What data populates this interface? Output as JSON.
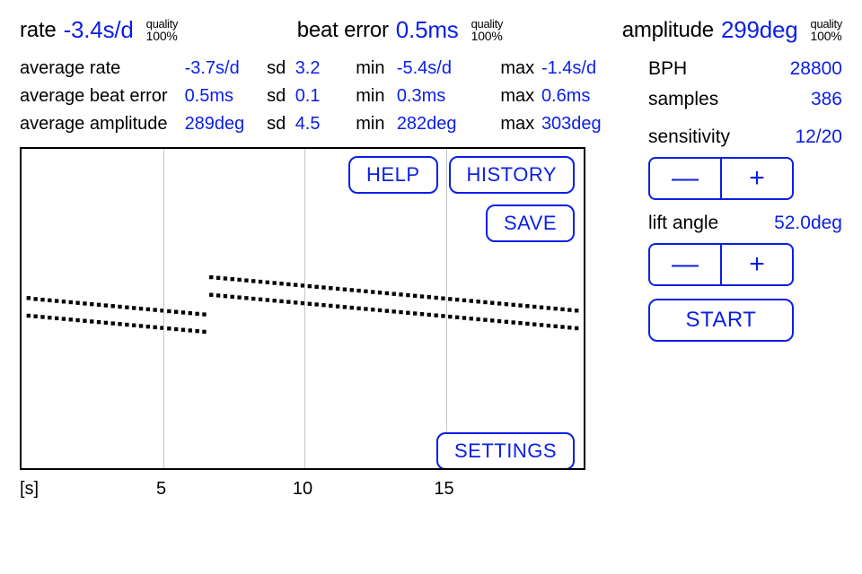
{
  "readings": {
    "rate": {
      "label": "rate",
      "value": "-3.4s/d",
      "quality_label": "quality",
      "quality": "100%"
    },
    "beat_error": {
      "label": "beat error",
      "value": "0.5ms",
      "quality_label": "quality",
      "quality": "100%"
    },
    "amplitude": {
      "label": "amplitude",
      "value": "299deg",
      "quality_label": "quality",
      "quality": "100%"
    }
  },
  "averages": {
    "rate": {
      "label": "average rate",
      "value": "-3.7s/d",
      "sd_label": "sd",
      "sd": "3.2",
      "min_label": "min",
      "min": "-5.4s/d",
      "max_label": "max",
      "max": "-1.4s/d"
    },
    "beat_error": {
      "label": "average beat error",
      "value": "0.5ms",
      "sd_label": "sd",
      "sd": "0.1",
      "min_label": "min",
      "min": "0.3ms",
      "max_label": "max",
      "max": "0.6ms"
    },
    "amplitude": {
      "label": "average amplitude",
      "value": "289deg",
      "sd_label": "sd",
      "sd": "4.5",
      "min_label": "min",
      "min": "282deg",
      "max_label": "max",
      "max": "303deg"
    }
  },
  "side": {
    "bph_label": "BPH",
    "bph": "28800",
    "samples_label": "samples",
    "samples": "386",
    "sensitivity_label": "sensitivity",
    "sensitivity": "12/20",
    "lift_label": "lift angle",
    "lift": "52.0deg",
    "minus": "—",
    "plus": "+",
    "start": "START"
  },
  "buttons": {
    "help": "HELP",
    "history": "HISTORY",
    "save": "SAVE",
    "settings": "SETTINGS"
  },
  "chart_data": {
    "type": "scatter",
    "xlabel": "[s]",
    "x_ticks": [
      "5",
      "10",
      "15"
    ],
    "x_range": [
      0,
      20
    ],
    "gridlines_x": [
      5,
      10,
      15
    ],
    "series": [
      {
        "name": "trace-upper",
        "points": [
          [
            0.25,
            0.535
          ],
          [
            0.5,
            0.532
          ],
          [
            0.75,
            0.53
          ],
          [
            1.0,
            0.528
          ],
          [
            1.25,
            0.526
          ],
          [
            1.5,
            0.524
          ],
          [
            1.75,
            0.522
          ],
          [
            2.0,
            0.52
          ],
          [
            2.25,
            0.518
          ],
          [
            2.5,
            0.516
          ],
          [
            2.75,
            0.514
          ],
          [
            3.0,
            0.512
          ],
          [
            3.25,
            0.51
          ],
          [
            3.5,
            0.508
          ],
          [
            3.75,
            0.506
          ],
          [
            4.0,
            0.504
          ],
          [
            4.25,
            0.502
          ],
          [
            4.5,
            0.5
          ],
          [
            4.75,
            0.498
          ],
          [
            5.0,
            0.496
          ],
          [
            5.25,
            0.494
          ],
          [
            5.5,
            0.492
          ],
          [
            5.75,
            0.49
          ],
          [
            6.0,
            0.488
          ],
          [
            6.25,
            0.486
          ],
          [
            6.5,
            0.484
          ],
          [
            6.75,
            0.6
          ],
          [
            7.0,
            0.598
          ],
          [
            7.25,
            0.596
          ],
          [
            7.5,
            0.594
          ],
          [
            7.75,
            0.592
          ],
          [
            8.0,
            0.59
          ],
          [
            8.25,
            0.588
          ],
          [
            8.5,
            0.586
          ],
          [
            8.75,
            0.584
          ],
          [
            9.0,
            0.582
          ],
          [
            9.25,
            0.58
          ],
          [
            9.5,
            0.578
          ],
          [
            9.75,
            0.576
          ],
          [
            10.0,
            0.574
          ],
          [
            10.25,
            0.572
          ],
          [
            10.5,
            0.57
          ],
          [
            10.75,
            0.568
          ],
          [
            11.0,
            0.566
          ],
          [
            11.25,
            0.564
          ],
          [
            11.5,
            0.562
          ],
          [
            11.75,
            0.56
          ],
          [
            12.0,
            0.558
          ],
          [
            12.25,
            0.556
          ],
          [
            12.5,
            0.554
          ],
          [
            12.75,
            0.552
          ],
          [
            13.0,
            0.55
          ],
          [
            13.25,
            0.548
          ],
          [
            13.5,
            0.546
          ],
          [
            13.75,
            0.544
          ],
          [
            14.0,
            0.542
          ],
          [
            14.25,
            0.54
          ],
          [
            14.5,
            0.538
          ],
          [
            14.75,
            0.536
          ],
          [
            15.0,
            0.534
          ],
          [
            15.25,
            0.532
          ],
          [
            15.5,
            0.53
          ],
          [
            15.75,
            0.528
          ],
          [
            16.0,
            0.526
          ],
          [
            16.25,
            0.524
          ],
          [
            16.5,
            0.522
          ],
          [
            16.75,
            0.52
          ],
          [
            17.0,
            0.518
          ],
          [
            17.25,
            0.516
          ],
          [
            17.5,
            0.514
          ],
          [
            17.75,
            0.512
          ],
          [
            18.0,
            0.51
          ],
          [
            18.25,
            0.508
          ],
          [
            18.5,
            0.506
          ],
          [
            18.75,
            0.504
          ],
          [
            19.0,
            0.502
          ],
          [
            19.25,
            0.5
          ],
          [
            19.5,
            0.498
          ],
          [
            19.75,
            0.496
          ]
        ]
      },
      {
        "name": "trace-lower",
        "points": [
          [
            0.25,
            0.48
          ],
          [
            0.5,
            0.478
          ],
          [
            0.75,
            0.476
          ],
          [
            1.0,
            0.474
          ],
          [
            1.25,
            0.472
          ],
          [
            1.5,
            0.47
          ],
          [
            1.75,
            0.468
          ],
          [
            2.0,
            0.466
          ],
          [
            2.25,
            0.464
          ],
          [
            2.5,
            0.462
          ],
          [
            2.75,
            0.46
          ],
          [
            3.0,
            0.458
          ],
          [
            3.25,
            0.456
          ],
          [
            3.5,
            0.454
          ],
          [
            3.75,
            0.452
          ],
          [
            4.0,
            0.45
          ],
          [
            4.25,
            0.448
          ],
          [
            4.5,
            0.446
          ],
          [
            4.75,
            0.444
          ],
          [
            5.0,
            0.442
          ],
          [
            5.25,
            0.44
          ],
          [
            5.5,
            0.438
          ],
          [
            5.75,
            0.436
          ],
          [
            6.0,
            0.434
          ],
          [
            6.25,
            0.432
          ],
          [
            6.5,
            0.43
          ],
          [
            6.75,
            0.545
          ],
          [
            7.0,
            0.543
          ],
          [
            7.25,
            0.541
          ],
          [
            7.5,
            0.539
          ],
          [
            7.75,
            0.537
          ],
          [
            8.0,
            0.535
          ],
          [
            8.25,
            0.533
          ],
          [
            8.5,
            0.531
          ],
          [
            8.75,
            0.529
          ],
          [
            9.0,
            0.527
          ],
          [
            9.25,
            0.525
          ],
          [
            9.5,
            0.523
          ],
          [
            9.75,
            0.521
          ],
          [
            10.0,
            0.519
          ],
          [
            10.25,
            0.517
          ],
          [
            10.5,
            0.515
          ],
          [
            10.75,
            0.513
          ],
          [
            11.0,
            0.511
          ],
          [
            11.25,
            0.509
          ],
          [
            11.5,
            0.507
          ],
          [
            11.75,
            0.505
          ],
          [
            12.0,
            0.503
          ],
          [
            12.25,
            0.501
          ],
          [
            12.5,
            0.499
          ],
          [
            12.75,
            0.497
          ],
          [
            13.0,
            0.495
          ],
          [
            13.25,
            0.493
          ],
          [
            13.5,
            0.491
          ],
          [
            13.75,
            0.489
          ],
          [
            14.0,
            0.487
          ],
          [
            14.25,
            0.485
          ],
          [
            14.5,
            0.483
          ],
          [
            14.75,
            0.481
          ],
          [
            15.0,
            0.479
          ],
          [
            15.25,
            0.477
          ],
          [
            15.5,
            0.475
          ],
          [
            15.75,
            0.473
          ],
          [
            16.0,
            0.471
          ],
          [
            16.25,
            0.469
          ],
          [
            16.5,
            0.467
          ],
          [
            16.75,
            0.465
          ],
          [
            17.0,
            0.463
          ],
          [
            17.25,
            0.461
          ],
          [
            17.5,
            0.459
          ],
          [
            17.75,
            0.457
          ],
          [
            18.0,
            0.455
          ],
          [
            18.25,
            0.453
          ],
          [
            18.5,
            0.451
          ],
          [
            18.75,
            0.449
          ],
          [
            19.0,
            0.447
          ],
          [
            19.25,
            0.445
          ],
          [
            19.5,
            0.443
          ],
          [
            19.75,
            0.441
          ]
        ]
      }
    ]
  }
}
